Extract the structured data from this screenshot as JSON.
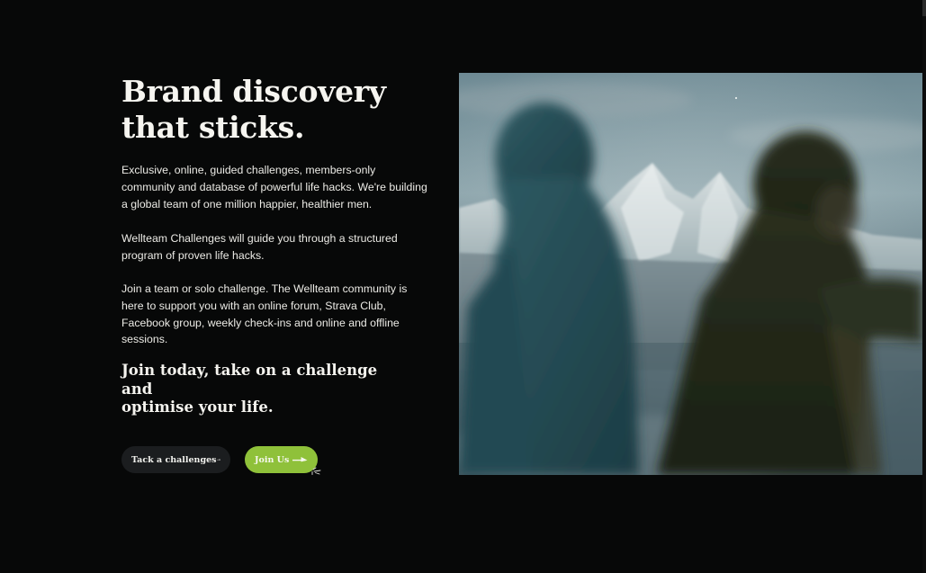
{
  "hero": {
    "headline": [
      "Brand discovery",
      "that sticks."
    ],
    "paragraphs": [
      "Exclusive, online, guided challenges, members-only community and database of powerful life hacks. We're building a global team of one million happier, healthier men.",
      "Wellteam Challenges will guide you through a structured program of proven life hacks.",
      "Join a team or solo challenge. The Wellteam community is here to support you with an online forum, Strava Club, Facebook group, weekly check-ins and online and offline sessions."
    ],
    "subheading": [
      "Join today, take on a challenge and",
      "optimise your life."
    ],
    "buttons": {
      "secondary": {
        "label": "Tack a challenges",
        "icon": "arrow-right-icon"
      },
      "primary": {
        "label": "Join Us",
        "icon": "arrow-right-icon"
      }
    }
  },
  "colors": {
    "background": "#070808",
    "text": "#f2f2ee",
    "accent_green": "#8fc13a",
    "secondary_button": "#1b1d1f"
  },
  "image": {
    "subject": "two blurred hooded figures in foreground with snowy mountain range behind"
  }
}
